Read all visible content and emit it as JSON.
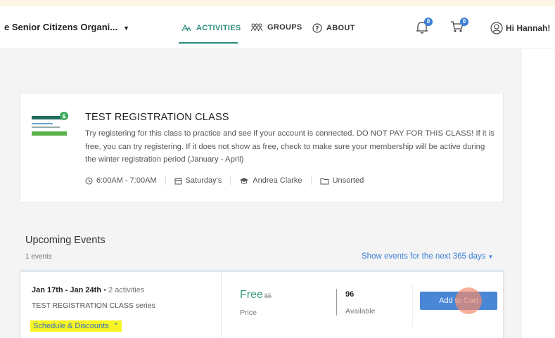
{
  "header": {
    "org_name": "e Senior Citizens Organi...",
    "nav": {
      "activities": "ACTIVITIES",
      "groups": "GROUPS",
      "about": "ABOUT"
    },
    "notifications_count": "0",
    "cart_count": "0",
    "user_greeting": "Hi Hannah!"
  },
  "activity": {
    "title": "TEST REGISTRATION CLASS",
    "description": "Try registering for this class to practice and see if your account is connected. DO NOT PAY FOR THIS CLASS! If it is free, you can try registering. If it does not show as free, check to make sure your membership will be active during the winter registration period (January - April)",
    "time": "6:00AM - 7:00AM",
    "day": "Saturday's",
    "instructor": "Andrea Clarke",
    "category": "Unsorted"
  },
  "upcoming": {
    "heading": "Upcoming Events",
    "count": "1 events",
    "range_label": "Show events for the next 365 days"
  },
  "event": {
    "dates": "Jan 17th - Jan 24th",
    "activities": "2 activities",
    "series": "TEST REGISTRATION CLASS series",
    "schedule_link": "Schedule & Discounts",
    "price": "Free",
    "original_price": "$5",
    "price_label": "Price",
    "available": "96",
    "available_label": "Available",
    "add_to_cart": "Add to Cart"
  },
  "colors": {
    "accent": "#2a8c7e",
    "link": "#3d7fd6",
    "button": "#4a86d6",
    "highlight": "#f7f422"
  }
}
